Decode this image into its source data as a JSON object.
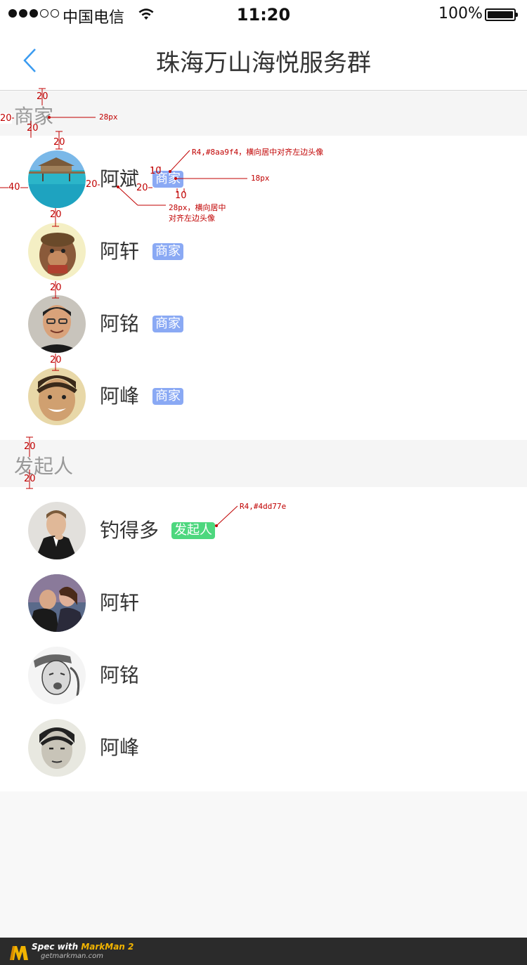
{
  "status_bar": {
    "carrier": "中国电信",
    "time": "11:20",
    "battery": "100%"
  },
  "navbar": {
    "title": "珠海万山海悦服务群",
    "back_icon": "chevron-left-icon"
  },
  "sections": [
    {
      "title": "商家",
      "members": [
        {
          "name": "阿斌",
          "tag": "商家"
        },
        {
          "name": "阿轩",
          "tag": "商家"
        },
        {
          "name": "阿铭",
          "tag": "商家"
        },
        {
          "name": "阿峰",
          "tag": "商家"
        }
      ]
    },
    {
      "title": "发起人",
      "members": [
        {
          "name": "钓得多",
          "tag": "发起人"
        },
        {
          "name": "阿轩"
        },
        {
          "name": "阿铭"
        },
        {
          "name": "阿峰"
        }
      ]
    }
  ],
  "annotations": {
    "n20": "20",
    "n40": "40",
    "n10": "10",
    "px28": "28px",
    "px18": "18px",
    "tag_merchant_note": "R4,#8aa9f4，横向居中对齐左边头像",
    "name_note_line1": "28px，横向居中",
    "name_note_line2": "对齐左边头像",
    "tag_initiator_note": "R4,#4dd77e"
  },
  "footer": {
    "spec_prefix": "Spec with ",
    "brand": "MarkMan 2",
    "url": "getmarkman.com"
  },
  "colors": {
    "merchant_tag": "#8aa9f4",
    "initiator_tag": "#4dd77e",
    "back_arrow": "#3a9bf0"
  }
}
